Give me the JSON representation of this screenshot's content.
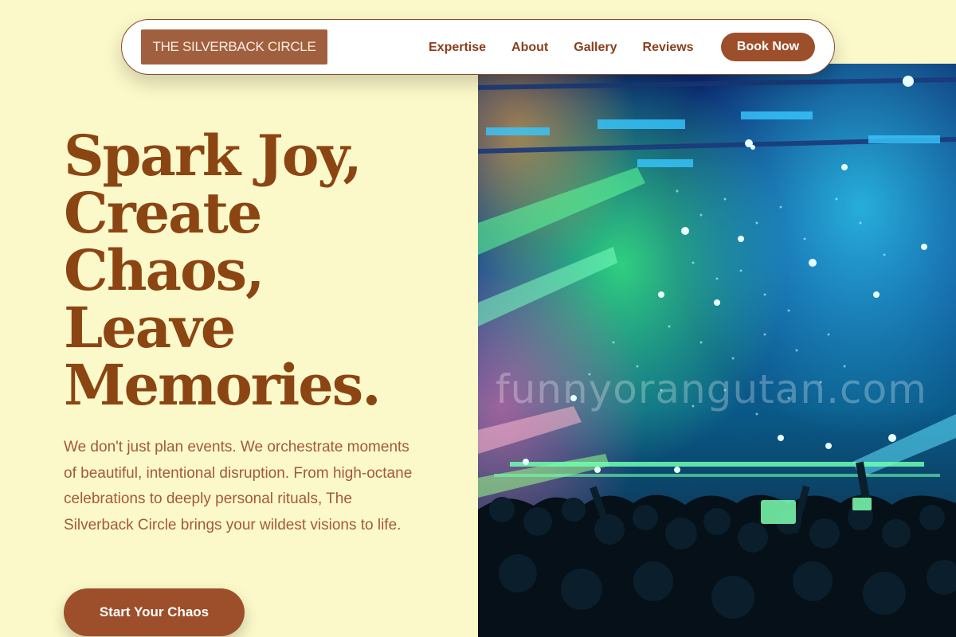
{
  "nav": {
    "brand": "THE SILVERBACK CIRCLE",
    "links": [
      "Expertise",
      "About",
      "Gallery",
      "Reviews"
    ],
    "cta": "Book Now"
  },
  "hero": {
    "headline": [
      "Spark Joy,",
      "Create",
      "Chaos,",
      "Leave",
      "Memories."
    ],
    "lede": "We don't just plan events. We orchestrate moments of beautiful, intentional disruption. From high-octane celebrations to deeply personal rituals, The Silverback Circle brings your wildest visions to life.",
    "cta": "Start Your Chaos"
  },
  "image": {
    "watermark": "funnyorangutan.com"
  },
  "colors": {
    "background": "#fbf8c9",
    "brand_brown": "#8b4513",
    "button_brown": "#9c4f2a",
    "brand_badge": "#a0603f",
    "text_soft": "#a35a3a"
  }
}
